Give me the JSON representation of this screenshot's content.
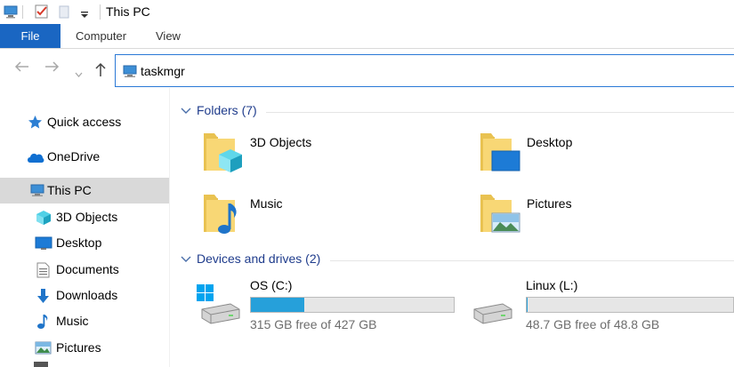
{
  "window": {
    "title": "This PC"
  },
  "ribbon": {
    "tabs": [
      {
        "label": "File",
        "active": true
      },
      {
        "label": "Computer",
        "active": false
      },
      {
        "label": "View",
        "active": false
      }
    ]
  },
  "address": {
    "path": "taskmgr",
    "icon": "computer-icon"
  },
  "sidebar": {
    "items": [
      {
        "label": "Quick access",
        "icon": "star-icon"
      },
      {
        "label": "OneDrive",
        "icon": "cloud-icon"
      },
      {
        "label": "This PC",
        "icon": "computer-icon",
        "selected": true
      },
      {
        "label": "3D Objects",
        "icon": "cube-icon"
      },
      {
        "label": "Desktop",
        "icon": "desktop-icon"
      },
      {
        "label": "Documents",
        "icon": "document-icon"
      },
      {
        "label": "Downloads",
        "icon": "download-arrow-icon"
      },
      {
        "label": "Music",
        "icon": "music-note-icon"
      },
      {
        "label": "Pictures",
        "icon": "picture-icon"
      }
    ]
  },
  "content": {
    "folders_header": "Folders (7)",
    "folders": [
      {
        "label": "3D Objects",
        "icon": "folder-3d-objects-icon"
      },
      {
        "label": "Desktop",
        "icon": "folder-desktop-icon"
      },
      {
        "label": "Music",
        "icon": "folder-music-icon"
      },
      {
        "label": "Pictures",
        "icon": "folder-pictures-icon"
      }
    ],
    "drives_header": "Devices and drives (2)",
    "drives": [
      {
        "label": "OS (C:)",
        "free_text": "315 GB free of 427 GB",
        "used_fraction": 0.262,
        "icon": "windows-drive-icon"
      },
      {
        "label": "Linux (L:)",
        "free_text": "48.7 GB free of 48.8 GB",
        "used_fraction": 0.002,
        "icon": "hard-drive-icon"
      }
    ]
  },
  "colors": {
    "accent": "#1a66c2",
    "drive_bar": "#26a0da",
    "group_header": "#1f3c8c",
    "selected_row": "#d9d9d9"
  }
}
